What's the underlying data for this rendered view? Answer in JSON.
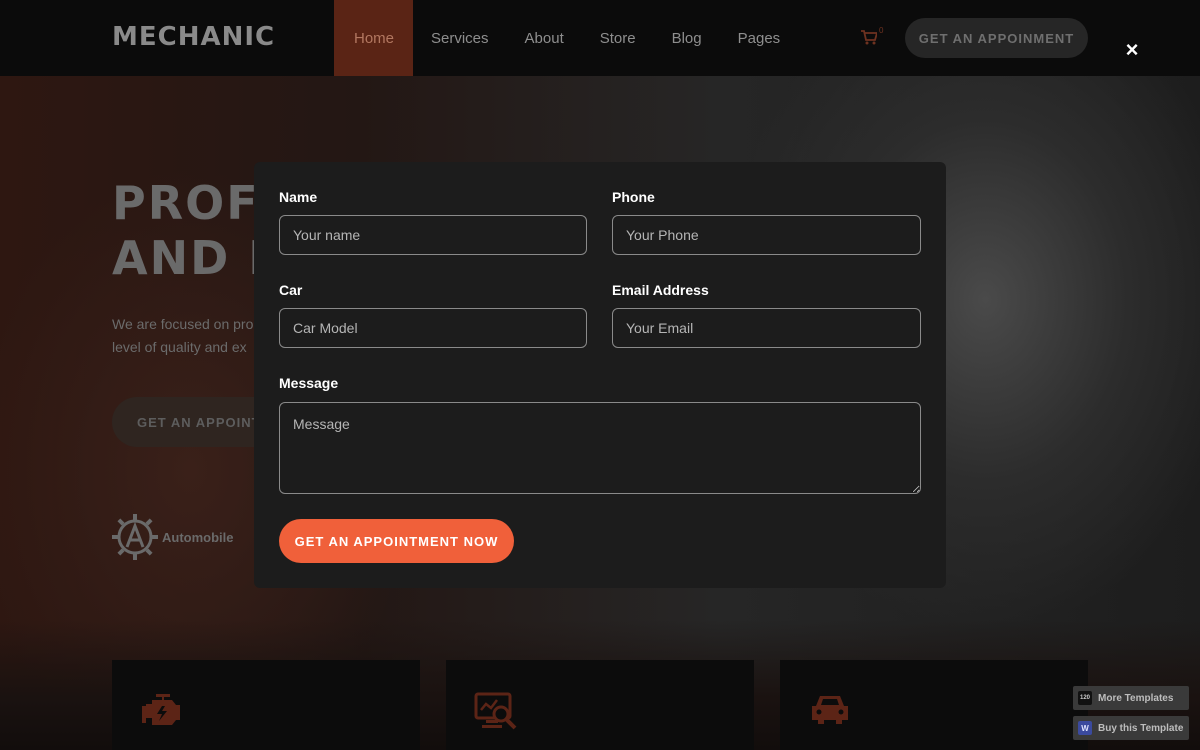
{
  "brand": {
    "logo": "MECHANIC"
  },
  "nav": {
    "items": [
      {
        "label": "Home",
        "active": true
      },
      {
        "label": "Services"
      },
      {
        "label": "About"
      },
      {
        "label": "Store"
      },
      {
        "label": "Blog"
      },
      {
        "label": "Pages"
      }
    ],
    "cart_count": "0",
    "cta_label": "GET AN APPOINMENT"
  },
  "hero": {
    "title_line1": "PROFE",
    "title_line2": "AND M",
    "text_line1": "We are focused on pro",
    "text_line2": "level of quality and ex",
    "cta_label": "GET AN APPOINTM",
    "partner_label": "Automobile"
  },
  "modal": {
    "close_label": "×",
    "fields": {
      "name": {
        "label": "Name",
        "placeholder": "Your name"
      },
      "phone": {
        "label": "Phone",
        "placeholder": "Your Phone"
      },
      "car": {
        "label": "Car",
        "placeholder": "Car Model"
      },
      "email": {
        "label": "Email Address",
        "placeholder": "Your Email"
      },
      "message": {
        "label": "Message",
        "placeholder": "Message"
      }
    },
    "submit_label": "GET AN APPOINTMENT NOW"
  },
  "promo": {
    "more_templates": "More Templates",
    "more_badge": "120",
    "buy_template": "Buy this Template",
    "buy_badge": "W"
  },
  "colors": {
    "accent": "#f0603a",
    "modal_bg": "#1c1c1c",
    "nav_bg": "#0b0b0b"
  }
}
